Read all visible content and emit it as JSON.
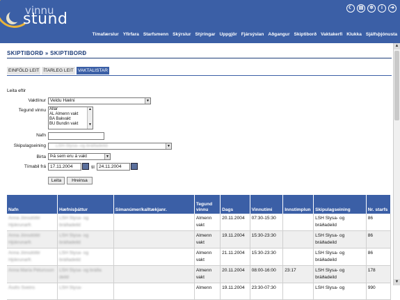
{
  "header": {
    "logo_top": "vinnu",
    "logo_bottom": "stund",
    "icons": [
      "moon-icon",
      "grid-icon",
      "gear-icon",
      "info-icon",
      "logout-icon"
    ],
    "icon_glyphs": [
      "☾",
      "▤",
      "✲",
      "i",
      "➜"
    ],
    "nav": [
      "Tímafærslur",
      "Yfirfara",
      "Starfsmenn",
      "Skýrslur",
      "Stýringar",
      "Uppgjör",
      "Fjársýslan",
      "Aðgangur",
      "Skiptiborð",
      "Vaktakerfi",
      "Klukka",
      "Sjálfsþjónusta"
    ]
  },
  "breadcrumb": "SKIPTIBORÐ » SKIPTIBORÐ",
  "tabs": [
    "EINFÖLD LEIT",
    "ÍTARLEG LEIT",
    "VAKTALISTAR"
  ],
  "form": {
    "title": "Leita eftir",
    "vaktlinur_label": "Vaktlínur",
    "vaktlinur_value": "Veldu Hælni",
    "tegund_label": "Tegund vinnu",
    "tegund_options": [
      "Allar",
      "AL Almenn vakt",
      "BA Bakvakt",
      "BU Bundin vakt"
    ],
    "nafn_label": "Nafn",
    "skipulag_label": "Skipulagseining",
    "skipulag_value": "LSH Slysa- og bráðadeild",
    "birta_label": "Birta",
    "birta_value": "Þá sem eru á vakt",
    "timabil_label": "Tímabil frá",
    "date_from": "17.11.2004",
    "til_label": "til",
    "date_to": "24.11.2004",
    "search_button": "Leita",
    "clear_button": "Hreinsa"
  },
  "table": {
    "columns": [
      "Nafn",
      "Hæfnisþáttur",
      "Símanúmer/kalltækjanr.",
      "Tegund vinnu",
      "Dags",
      "Vinnutími",
      "Innstimplun",
      "Skipulagseining",
      "Nr. starfs"
    ],
    "rows": [
      {
        "nafn": [
          "Anna Jónsdóttir",
          "Hjúkrunarfr."
        ],
        "haefni": [
          "LSH Slysa- og",
          "bráðadeild"
        ],
        "simi": "",
        "tegund": [
          "Almenn",
          "vakt"
        ],
        "dags": "20.11.2004",
        "vinnutimi": "07:30-15:30",
        "inn": "",
        "skipulag": [
          "LSH Slysa- og",
          "bráðadeild"
        ],
        "nr": "86"
      },
      {
        "nafn": [
          "Anna Jónsdóttir",
          "Hjúkrunarfr."
        ],
        "haefni": [
          "LSH Slysa- og",
          "bráðadeild"
        ],
        "simi": "",
        "tegund": [
          "Almenn",
          "vakt"
        ],
        "dags": "19.11.2004",
        "vinnutimi": "15:30-23:30",
        "inn": "",
        "skipulag": [
          "LSH Slysa- og",
          "bráðadeild"
        ],
        "nr": "86"
      },
      {
        "nafn": [
          "Anna Jónsdóttir",
          "Hjúkrunarfr."
        ],
        "haefni": [
          "LSH Slysa- og",
          "bráðadeild"
        ],
        "simi": "",
        "tegund": [
          "Almenn",
          "vakt"
        ],
        "dags": "21.11.2004",
        "vinnutimi": "15:30-23:30",
        "inn": "",
        "skipulag": [
          "LSH Slysa- og",
          "bráðadeild"
        ],
        "nr": "86"
      },
      {
        "nafn": [
          "Anna María Pétursson",
          ""
        ],
        "haefni": [
          "LSH Slysa- og bráða",
          "deild"
        ],
        "simi": "",
        "tegund": [
          "Almenn",
          "vakt"
        ],
        "dags": "20.11.2004",
        "vinnutimi": "08:00-16:00",
        "inn": "23:17",
        "skipulag": [
          "LSH Slysa- og",
          "bráðadeild"
        ],
        "nr": "178"
      },
      {
        "nafn": [
          "Ásdís Sveins",
          ""
        ],
        "haefni": [
          "LSH Slysa-",
          ""
        ],
        "simi": "",
        "tegund": [
          "Almenn",
          ""
        ],
        "dags": "19.11.2004",
        "vinnutimi": "23:30-07:30",
        "inn": "",
        "skipulag": [
          "LSH Slysa- og",
          ""
        ],
        "nr": "990"
      }
    ]
  }
}
